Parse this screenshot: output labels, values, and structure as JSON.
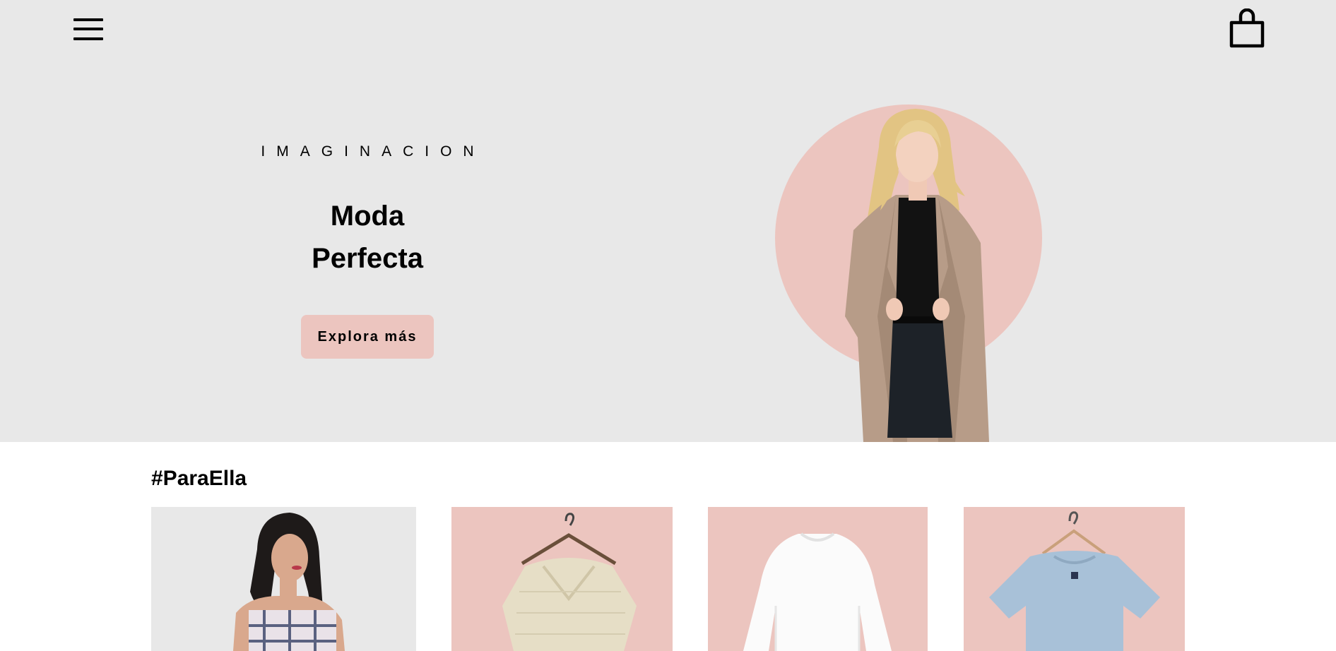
{
  "header": {
    "menu_icon": "hamburger-menu-icon",
    "cart_icon": "shopping-bag-icon"
  },
  "hero": {
    "tagline": "IMAGINACION",
    "headline_line1": "Moda",
    "headline_line2": "Perfecta",
    "cta_label": "Explora más",
    "image_subject": "woman-in-camel-coat",
    "colors": {
      "background": "#e8e8e8",
      "accent": "#ecc5bf",
      "text": "#000000"
    }
  },
  "collection": {
    "title": "#ParaElla",
    "items": [
      {
        "image_subject": "woman-in-plaid-top",
        "background": "#e8e8e8"
      },
      {
        "image_subject": "knit-sweater-on-hanger",
        "background": "#ecc5bf"
      },
      {
        "image_subject": "white-long-sleeve-shirt",
        "background": "#ecc5bf"
      },
      {
        "image_subject": "blue-tshirt-on-hanger",
        "background": "#ecc5bf"
      }
    ]
  }
}
